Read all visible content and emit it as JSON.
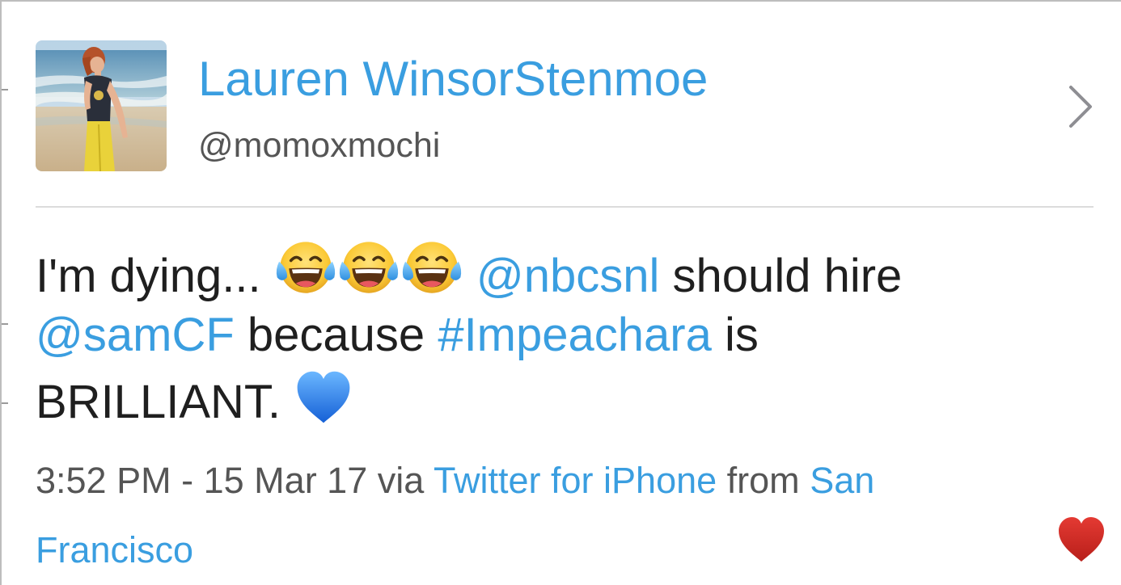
{
  "profile": {
    "display_name": "Lauren WinsorStenmoe",
    "handle": "@momoxmochi",
    "avatar_icon": "profile-photo-girl-on-beach"
  },
  "tweet": {
    "text_1": "I'm dying...",
    "emoji_laugh": "face-with-tears-of-joy",
    "mention_1": "@nbcsnl",
    "text_2": "should hire",
    "mention_2": "@samCF",
    "text_3": "because",
    "hashtag": "#Impeachara",
    "text_4": "is",
    "text_5": "BRILLIANT.",
    "emoji_heart": "blue-heart"
  },
  "meta": {
    "time": "3:52 PM",
    "separator": "-",
    "date": "15 Mar 17",
    "via_label": "via",
    "source": "Twitter for iPhone",
    "from_label": "from",
    "location_1": "San",
    "location_2": "Francisco"
  },
  "colors": {
    "link_blue": "#3a9ee0",
    "text_dark": "#1f1f1f",
    "text_gray": "#555555",
    "like_red": "#d42a27"
  },
  "icons": {
    "chevron": "chevron-right-icon",
    "like": "heart-icon"
  }
}
